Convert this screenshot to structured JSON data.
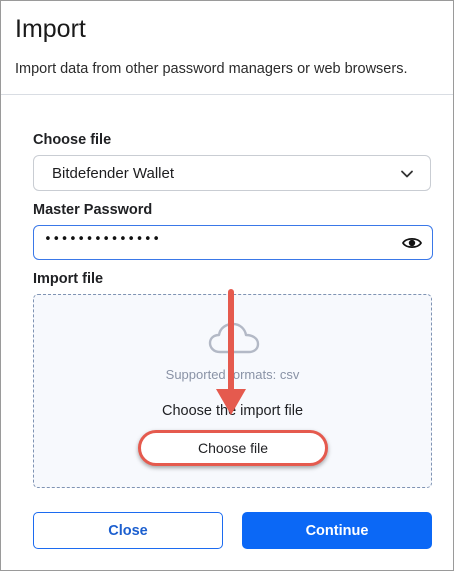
{
  "dialog": {
    "title": "Import",
    "subtitle": "Import data from other password managers or web browsers."
  },
  "form": {
    "choose_file_label": "Choose file",
    "choose_file_value": "Bitdefender Wallet",
    "master_password_label": "Master Password",
    "master_password_value": "••••••••••••••",
    "import_file_label": "Import file"
  },
  "dropzone": {
    "icon": "cloud-icon",
    "supported_formats": "Supported formats: csv",
    "instruction": "Choose the import file",
    "button_label": "Choose file"
  },
  "footer": {
    "close_label": "Close",
    "continue_label": "Continue"
  },
  "colors": {
    "accent": "#0b68f6",
    "annotation": "#e55a4e"
  }
}
